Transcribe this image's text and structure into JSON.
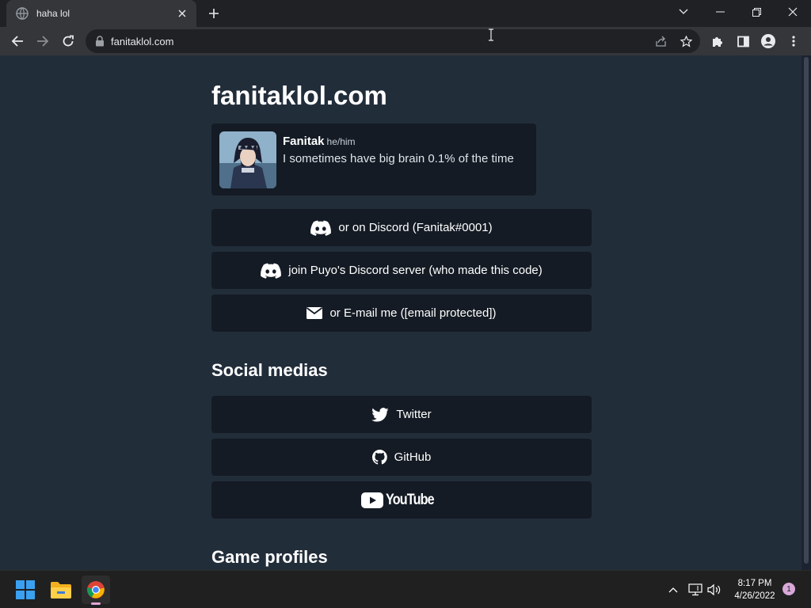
{
  "browser": {
    "tab_title": "haha lol",
    "url": "fanitaklol.com"
  },
  "page": {
    "site_title": "fanitaklol.com",
    "profile": {
      "name": "Fanitak",
      "pronouns": "he/him",
      "bio": "I sometimes have big brain 0.1% of the time"
    },
    "contact_links": [
      {
        "label": "or on Discord (Fanitak#0001)",
        "icon": "discord-icon"
      },
      {
        "label": "join Puyo's Discord server (who made this code)",
        "icon": "discord-icon"
      },
      {
        "label": "or E-mail me ([email protected])",
        "icon": "mail-icon"
      }
    ],
    "social_heading": "Social medias",
    "social_links": [
      {
        "label": "Twitter",
        "icon": "twitter-icon"
      },
      {
        "label": "GitHub",
        "icon": "github-icon"
      },
      {
        "label": "YouTube",
        "icon": "youtube-logo"
      }
    ],
    "game_heading": "Game profiles"
  },
  "taskbar": {
    "time": "8:17 PM",
    "date": "4/26/2022",
    "notification_count": "1"
  }
}
